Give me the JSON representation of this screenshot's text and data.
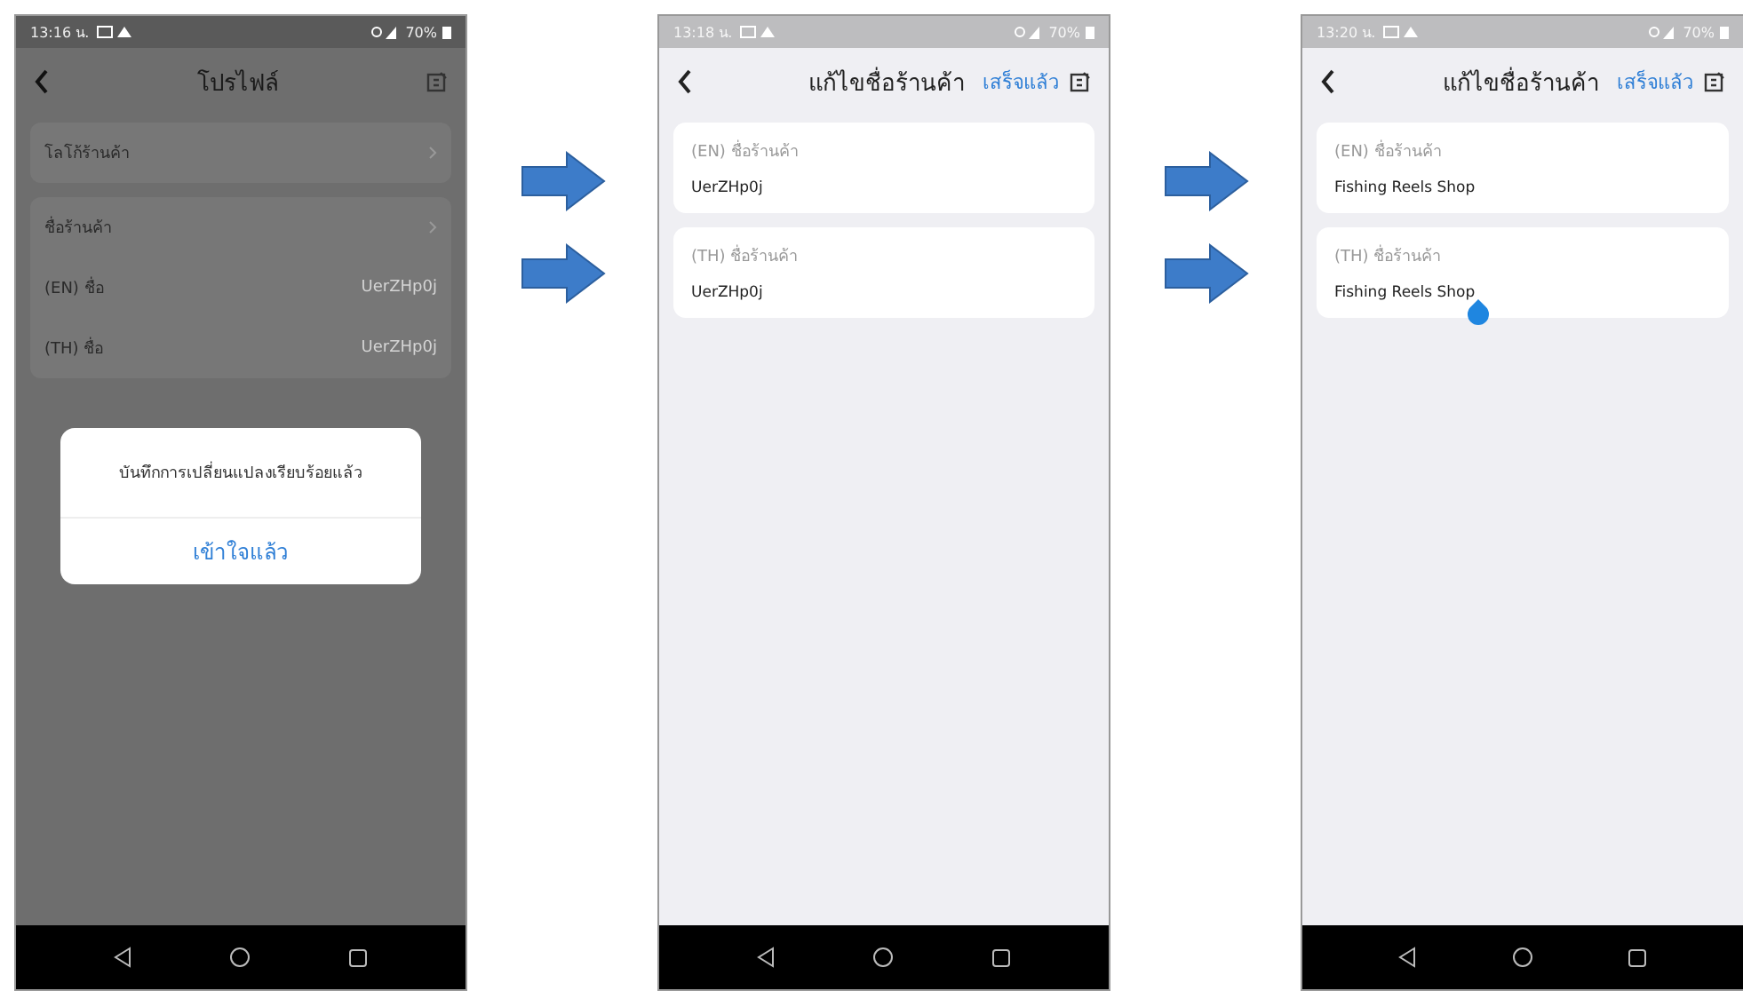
{
  "screens": [
    {
      "kind": "profile",
      "time": "13:16 น.",
      "battery": "70%",
      "title": "โปรไฟล์",
      "logo_row": {
        "label": "โลโก้ร้านค้า"
      },
      "name_group": {
        "label": "ชื่อร้านค้า",
        "rows": [
          {
            "label": "(EN) ชื่อ",
            "value": "UerZHp0j"
          },
          {
            "label": "(TH) ชื่อ",
            "value": "UerZHp0j"
          }
        ]
      },
      "dialog": {
        "message": "บันทึกการเปลี่ยนแปลงเรียบร้อยแล้ว",
        "button": "เข้าใจแล้ว"
      }
    },
    {
      "kind": "edit",
      "time": "13:18 น.",
      "battery": "70%",
      "title": "แก้ไขชื่อร้านค้า",
      "done": "เสร็จแล้ว",
      "fields": [
        {
          "label": "(EN) ชื่อร้านค้า",
          "value": "UerZHp0j",
          "cursor": false
        },
        {
          "label": "(TH) ชื่อร้านค้า",
          "value": "UerZHp0j",
          "cursor": false
        }
      ]
    },
    {
      "kind": "edit",
      "time": "13:20 น.",
      "battery": "70%",
      "title": "แก้ไขชื่อร้านค้า",
      "done": "เสร็จแล้ว",
      "fields": [
        {
          "label": "(EN) ชื่อร้านค้า",
          "value": "Fishing Reels Shop",
          "cursor": false
        },
        {
          "label": "(TH) ชื่อร้านค้า",
          "value": "Fishing Reels Shop",
          "cursor": true
        }
      ]
    }
  ]
}
